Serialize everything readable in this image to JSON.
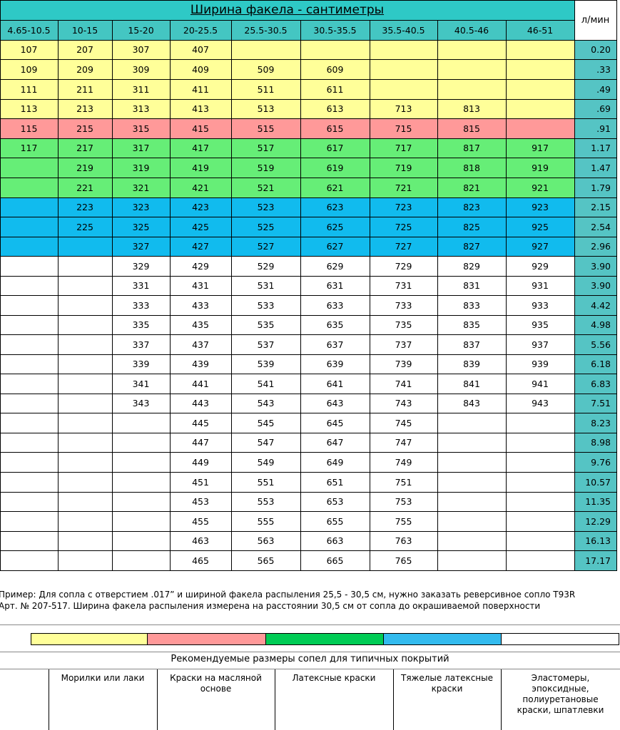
{
  "title": "Ширина факела - сантиметры",
  "flow_header": "л/мин",
  "width_headers": [
    "4.65-10.5",
    "10-15",
    "15-20",
    "20-25.5",
    "25.5-30.5",
    "30.5-35.5",
    "35.5-40.5",
    "40.5-46",
    "46-51"
  ],
  "rows": [
    {
      "cells": [
        "107",
        "207",
        "307",
        "407",
        "",
        "",
        "",
        "",
        ""
      ],
      "flow": "0.20",
      "color": "yellow"
    },
    {
      "cells": [
        "109",
        "209",
        "309",
        "409",
        "509",
        "609",
        "",
        "",
        ""
      ],
      "flow": ".33",
      "color": "yellow"
    },
    {
      "cells": [
        "111",
        "211",
        "311",
        "411",
        "511",
        "611",
        "",
        "",
        ""
      ],
      "flow": ".49",
      "color": "yellow"
    },
    {
      "cells": [
        "113",
        "213",
        "313",
        "413",
        "513",
        "613",
        "713",
        "813",
        ""
      ],
      "flow": ".69",
      "color": "yellow"
    },
    {
      "cells": [
        "115",
        "215",
        "315",
        "415",
        "515",
        "615",
        "715",
        "815",
        ""
      ],
      "flow": ".91",
      "color": "red"
    },
    {
      "cells": [
        "117",
        "217",
        "317",
        "417",
        "517",
        "617",
        "717",
        "817",
        "917"
      ],
      "flow": "1.17",
      "color": "green"
    },
    {
      "cells": [
        "",
        "219",
        "319",
        "419",
        "519",
        "619",
        "719",
        "818",
        "919"
      ],
      "flow": "1.47",
      "color": "green"
    },
    {
      "cells": [
        "",
        "221",
        "321",
        "421",
        "521",
        "621",
        "721",
        "821",
        "921"
      ],
      "flow": "1.79",
      "color": "green"
    },
    {
      "cells": [
        "",
        "223",
        "323",
        "423",
        "523",
        "623",
        "723",
        "823",
        "923"
      ],
      "flow": "2.15",
      "color": "blue"
    },
    {
      "cells": [
        "",
        "225",
        "325",
        "425",
        "525",
        "625",
        "725",
        "825",
        "925"
      ],
      "flow": "2.54",
      "color": "blue"
    },
    {
      "cells": [
        "",
        "",
        "327",
        "427",
        "527",
        "627",
        "727",
        "827",
        "927"
      ],
      "flow": "2.96",
      "color": "blue"
    },
    {
      "cells": [
        "",
        "",
        "329",
        "429",
        "529",
        "629",
        "729",
        "829",
        "929"
      ],
      "flow": "3.90",
      "color": "white"
    },
    {
      "cells": [
        "",
        "",
        "331",
        "431",
        "531",
        "631",
        "731",
        "831",
        "931"
      ],
      "flow": "3.90",
      "color": "white"
    },
    {
      "cells": [
        "",
        "",
        "333",
        "433",
        "533",
        "633",
        "733",
        "833",
        "933"
      ],
      "flow": "4.42",
      "color": "white"
    },
    {
      "cells": [
        "",
        "",
        "335",
        "435",
        "535",
        "635",
        "735",
        "835",
        "935"
      ],
      "flow": "4.98",
      "color": "white"
    },
    {
      "cells": [
        "",
        "",
        "337",
        "437",
        "537",
        "637",
        "737",
        "837",
        "937"
      ],
      "flow": "5.56",
      "color": "white"
    },
    {
      "cells": [
        "",
        "",
        "339",
        "439",
        "539",
        "639",
        "739",
        "839",
        "939"
      ],
      "flow": "6.18",
      "color": "white"
    },
    {
      "cells": [
        "",
        "",
        "341",
        "441",
        "541",
        "641",
        "741",
        "841",
        "941"
      ],
      "flow": "6.83",
      "color": "white"
    },
    {
      "cells": [
        "",
        "",
        "343",
        "443",
        "543",
        "643",
        "743",
        "843",
        "943"
      ],
      "flow": "7.51",
      "color": "white"
    },
    {
      "cells": [
        "",
        "",
        "",
        "445",
        "545",
        "645",
        "745",
        "",
        ""
      ],
      "flow": "8.23",
      "color": "white"
    },
    {
      "cells": [
        "",
        "",
        "",
        "447",
        "547",
        "647",
        "747",
        "",
        ""
      ],
      "flow": "8.98",
      "color": "white"
    },
    {
      "cells": [
        "",
        "",
        "",
        "449",
        "549",
        "649",
        "749",
        "",
        ""
      ],
      "flow": "9.76",
      "color": "white"
    },
    {
      "cells": [
        "",
        "",
        "",
        "451",
        "551",
        "651",
        "751",
        "",
        ""
      ],
      "flow": "10.57",
      "color": "white"
    },
    {
      "cells": [
        "",
        "",
        "",
        "453",
        "553",
        "653",
        "753",
        "",
        ""
      ],
      "flow": "11.35",
      "color": "white"
    },
    {
      "cells": [
        "",
        "",
        "",
        "455",
        "555",
        "655",
        "755",
        "",
        ""
      ],
      "flow": "12.29",
      "color": "white"
    },
    {
      "cells": [
        "",
        "",
        "",
        "463",
        "563",
        "663",
        "763",
        "",
        ""
      ],
      "flow": "16.13",
      "color": "white"
    },
    {
      "cells": [
        "",
        "",
        "",
        "465",
        "565",
        "665",
        "765",
        "",
        ""
      ],
      "flow": "17.17",
      "color": "white"
    }
  ],
  "note_line1": "Пример: Для сопла с отверстием .017” и шириной факела распыления 25,5 - 30,5 см, нужно заказать реверсивное сопло T93R",
  "note_line2": "Арт. № 207-517. Ширина факела распыления измерена на расстоянии 30,5 см от сопла до окрашиваемой поверхности",
  "legend_colors": [
    "#ffff99",
    "#ff9999",
    "#00cc55",
    "#33bbee",
    "#ffffff"
  ],
  "recommend_title": "Рекомендуемые размеры сопел для типичных покрытий",
  "categories": [
    "Морилки или лаки",
    "Краски на масляной основе",
    "Латексные краски",
    "Тяжелые латексные краски",
    "Эластомеры, эпоксидные, полиуретановые краски, шпатлевки"
  ]
}
